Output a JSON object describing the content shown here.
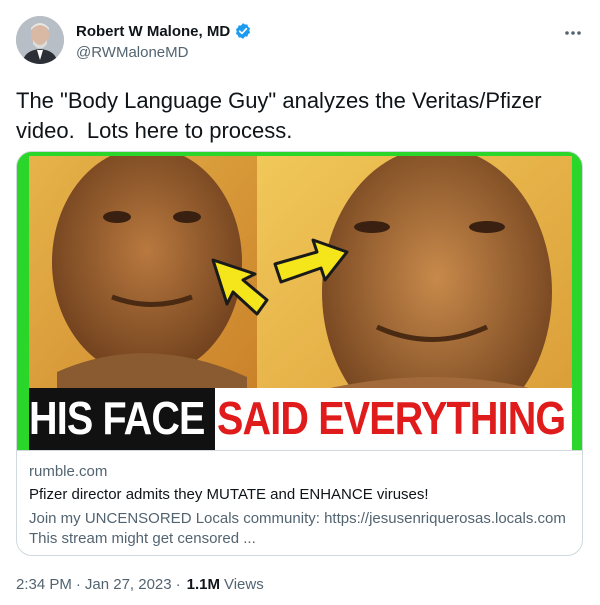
{
  "author": {
    "name": "Robert W Malone, MD",
    "handle": "@RWMaloneMD",
    "verified_color": "#1d9bf0"
  },
  "more_icon": "ellipsis-icon",
  "tweet": {
    "text": "The \"Body Language Guy\" analyzes the Veritas/Pfizer video.  Lots here to process."
  },
  "card": {
    "thumbnail": {
      "overlay_left": "HIS FACE",
      "overlay_right": "SAID EVERYTHING",
      "border_color": "#2bd62b",
      "arrow_color": "#f5e51b"
    },
    "domain": "rumble.com",
    "title": "Pfizer director admits they MUTATE and ENHANCE viruses!",
    "description": "Join my UNCENSORED Locals community: https://jesusenriquerosas.locals.com This stream might get censored ..."
  },
  "footer": {
    "time": "2:34 PM",
    "date": "Jan 27, 2023",
    "views_count": "1.1M",
    "views_label": "Views"
  }
}
